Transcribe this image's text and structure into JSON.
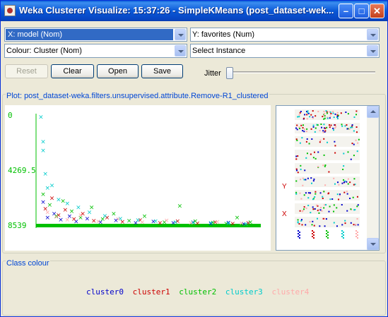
{
  "window": {
    "title": "Weka Clusterer Visualize: 15:37:26 - SimpleKMeans (post_dataset-wek..."
  },
  "controls": {
    "x_axis": "X: model (Nom)",
    "y_axis": "Y: favorites (Num)",
    "colour": "Colour: Cluster (Nom)",
    "select": "Select Instance",
    "reset": "Reset",
    "clear": "Clear",
    "open": "Open",
    "save": "Save",
    "jitter": "Jitter",
    "jitter_level": 0
  },
  "plot": {
    "title": "Plot: post_dataset-weka.filters.unsupervised.attribute.Remove-R1_clustered",
    "y_ticks": [
      "8539",
      "4269.5",
      "0"
    ]
  },
  "attr_panel": {
    "markers": [
      "Y",
      "X"
    ]
  },
  "class_colour": {
    "title": "Class colour",
    "clusters": [
      {
        "name": "cluster0",
        "color": "#0000cc"
      },
      {
        "name": "cluster1",
        "color": "#cc0000"
      },
      {
        "name": "cluster2",
        "color": "#00c000"
      },
      {
        "name": "cluster3",
        "color": "#00cccc"
      },
      {
        "name": "cluster4",
        "color": "#ffaaaa"
      }
    ]
  },
  "chart_data": {
    "type": "scatter",
    "title": "Plot: post_dataset-weka.filters.unsupervised.attribute.Remove-R1_clustered",
    "xlabel": "model",
    "ylabel": "favorites",
    "ylim": [
      0,
      8539
    ],
    "y_ticks": [
      0,
      4269.5,
      8539
    ],
    "series": [
      {
        "name": "cluster0",
        "color": "#0000cc",
        "points": [
          [
            0.02,
            1800
          ],
          [
            0.04,
            600
          ],
          [
            0.07,
            900
          ],
          [
            0.1,
            450
          ],
          [
            0.14,
            700
          ],
          [
            0.17,
            300
          ],
          [
            0.22,
            520
          ],
          [
            0.28,
            260
          ],
          [
            0.35,
            380
          ],
          [
            0.44,
            200
          ],
          [
            0.52,
            300
          ],
          [
            0.61,
            180
          ],
          [
            0.7,
            240
          ],
          [
            0.78,
            150
          ],
          [
            0.86,
            220
          ],
          [
            0.93,
            120
          ]
        ]
      },
      {
        "name": "cluster1",
        "color": "#cc0000",
        "points": [
          [
            0.03,
            1300
          ],
          [
            0.06,
            2100
          ],
          [
            0.09,
            800
          ],
          [
            0.12,
            1200
          ],
          [
            0.16,
            500
          ],
          [
            0.2,
            900
          ],
          [
            0.25,
            350
          ],
          [
            0.31,
            600
          ],
          [
            0.38,
            280
          ],
          [
            0.46,
            420
          ],
          [
            0.55,
            200
          ],
          [
            0.63,
            330
          ],
          [
            0.72,
            160
          ],
          [
            0.8,
            260
          ],
          [
            0.88,
            140
          ],
          [
            0.95,
            200
          ]
        ]
      },
      {
        "name": "cluster2",
        "color": "#00c000",
        "points": [
          [
            0.02,
            2400
          ],
          [
            0.05,
            1600
          ],
          [
            0.08,
            700
          ],
          [
            0.11,
            1900
          ],
          [
            0.15,
            1100
          ],
          [
            0.19,
            600
          ],
          [
            0.24,
            1400
          ],
          [
            0.29,
            500
          ],
          [
            0.34,
            900
          ],
          [
            0.41,
            350
          ],
          [
            0.48,
            700
          ],
          [
            0.57,
            260
          ],
          [
            0.64,
            1500
          ],
          [
            0.71,
            320
          ],
          [
            0.79,
            220
          ],
          [
            0.85,
            140
          ],
          [
            0.9,
            600
          ],
          [
            0.96,
            250
          ]
        ]
      },
      {
        "name": "cluster3",
        "color": "#00cccc",
        "points": [
          [
            0.01,
            8400
          ],
          [
            0.02,
            6500
          ],
          [
            0.02,
            5800
          ],
          [
            0.03,
            4000
          ],
          [
            0.04,
            2900
          ],
          [
            0.06,
            3100
          ],
          [
            0.09,
            2000
          ],
          [
            0.13,
            1700
          ],
          [
            0.18,
            1400
          ],
          [
            0.23,
            1000
          ],
          [
            0.3,
            750
          ],
          [
            0.37,
            520
          ],
          [
            0.45,
            400
          ],
          [
            0.53,
            320
          ],
          [
            0.62,
            260
          ],
          [
            0.7,
            220
          ],
          [
            0.78,
            180
          ],
          [
            0.86,
            160
          ],
          [
            0.94,
            120
          ]
        ]
      },
      {
        "name": "cluster4",
        "color": "#ffaaaa",
        "points": [
          [
            0.04,
            1000
          ],
          [
            0.08,
            650
          ],
          [
            0.13,
            450
          ],
          [
            0.19,
            800
          ],
          [
            0.27,
            300
          ],
          [
            0.36,
            500
          ],
          [
            0.47,
            250
          ],
          [
            0.58,
            380
          ],
          [
            0.69,
            200
          ],
          [
            0.81,
            280
          ],
          [
            0.92,
            160
          ]
        ]
      }
    ]
  }
}
